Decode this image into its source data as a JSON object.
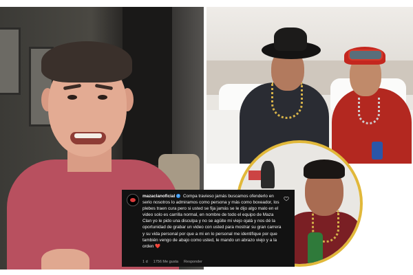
{
  "comment": {
    "username": "mazaclanoficial",
    "verified_glyph": "✓",
    "body": "Compa travieso jamás buscamos ofenderlo en serio nosotros lo admiramos como persona y más como boxeador, los plebes traen cura pero si usted se fija jamás se le dijo algo malo en el video solo es carrilla normal, en nombre de todo el equipo de Maza Clan yo le pido una disculpa y no se agüite mi viejo ojalá y nos dé la oportunidad de grabar un video con usted para mostrar su gran carrera y su vida personal por que a mi en lo personal me identifique por que también vengo de abajo como usted, le mando un abrazo viejo y a la orden",
    "trailing_emoji": "❤️",
    "time": "1 d",
    "likes": "1756 Me gusta",
    "reply_label": "Responder",
    "icons": {
      "avatar": "brand-logo-avatar",
      "like": "heart-outline-icon",
      "verified": "verified-badge-icon"
    },
    "colors": {
      "background": "#121212",
      "text": "#f5f5f5",
      "meta": "#a8a8a8",
      "verified": "#3897f0",
      "heart": "#e0245e"
    }
  },
  "inset": {
    "border_color": "#e1b83a"
  }
}
